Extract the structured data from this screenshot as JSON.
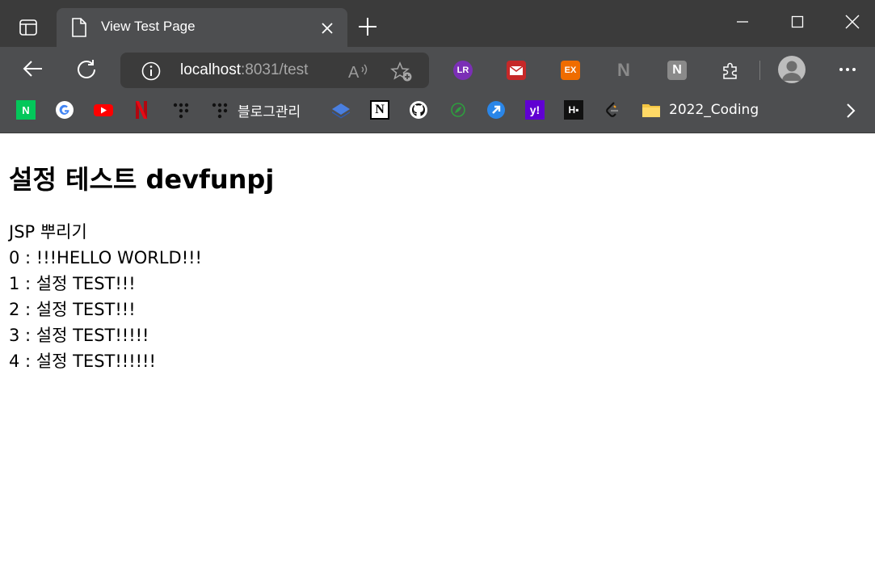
{
  "tab": {
    "title": "View Test Page"
  },
  "addressbar": {
    "host": "localhost",
    "path": ":8031/test"
  },
  "bookmarks": {
    "items": [
      {
        "icon": "naver-icon",
        "label": ""
      },
      {
        "icon": "google-icon",
        "label": ""
      },
      {
        "icon": "youtube-icon",
        "label": ""
      },
      {
        "icon": "netflix-icon",
        "label": ""
      },
      {
        "icon": "tistory-icon",
        "label": ""
      },
      {
        "icon": "tistory-icon",
        "label": "블로그관리"
      },
      {
        "icon": "stack-icon",
        "label": ""
      },
      {
        "icon": "notion-icon",
        "label": ""
      },
      {
        "icon": "github-icon",
        "label": ""
      },
      {
        "icon": "leaf-icon",
        "label": ""
      },
      {
        "icon": "arrow-badge-icon",
        "label": ""
      },
      {
        "icon": "yahoo-icon",
        "label": ""
      },
      {
        "icon": "hackerrank-icon",
        "label": ""
      },
      {
        "icon": "leetcode-icon",
        "label": ""
      },
      {
        "icon": "folder-icon",
        "label": "2022_Coding"
      }
    ]
  },
  "extensions": [
    {
      "icon": "lr-extension-icon",
      "text": "LR"
    },
    {
      "icon": "mail-extension-icon",
      "text": ""
    },
    {
      "icon": "ex-extension-icon",
      "text": "EX"
    },
    {
      "icon": "n-dark-extension-icon",
      "text": "N"
    },
    {
      "icon": "n-extension-icon",
      "text": "N"
    }
  ],
  "page": {
    "heading": "설정 테스트 devfunpj",
    "lines": [
      "JSP 뿌리기",
      "0 : !!!HELLO WORLD!!!",
      "1 : 설정 TEST!!!",
      "2 : 설정 TEST!!!",
      "3 : 설정 TEST!!!!!",
      "4 : 설정 TEST!!!!!!"
    ]
  },
  "colors": {
    "titlebar": "#3b3b3b",
    "toolbar": "#4d4e50",
    "page_background": "#ffffff"
  }
}
